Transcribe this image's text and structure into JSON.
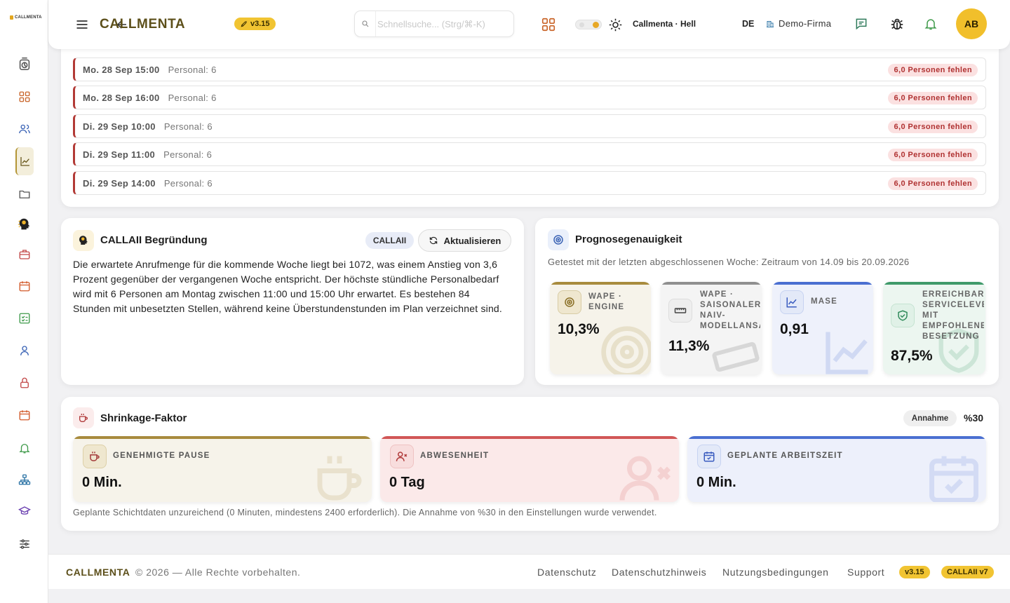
{
  "app": {
    "logo_text": "CALLMENTA",
    "brand": "CALLMENTA",
    "version": "v3.15"
  },
  "search": {
    "placeholder": "Schnellsuche... (Strg/⌘-K)",
    "value": ""
  },
  "header": {
    "theme_label": "Callmenta · Hell",
    "language": "DE",
    "company": "Demo-Firma",
    "avatar_initials": "AB"
  },
  "sidebar": {
    "items": [
      {
        "name": "sidebar-item-timer",
        "icon": "timer-icon"
      },
      {
        "name": "sidebar-item-dashboard",
        "icon": "grid-icon"
      },
      {
        "name": "sidebar-item-team",
        "icon": "users-icon"
      },
      {
        "name": "sidebar-item-forecast",
        "icon": "chart-line-icon",
        "active": true
      },
      {
        "name": "sidebar-item-files",
        "icon": "folder-icon"
      },
      {
        "name": "sidebar-item-ai",
        "icon": "ai-head-icon"
      },
      {
        "name": "sidebar-item-jobs",
        "icon": "briefcase-icon"
      },
      {
        "name": "sidebar-item-calendar",
        "icon": "calendar-icon"
      },
      {
        "name": "sidebar-item-tasks",
        "icon": "checklist-icon"
      },
      {
        "name": "sidebar-item-profile",
        "icon": "user-icon"
      },
      {
        "name": "sidebar-item-security",
        "icon": "lock-icon"
      },
      {
        "name": "sidebar-item-schedule",
        "icon": "calendar-alt-icon"
      },
      {
        "name": "sidebar-item-notifications",
        "icon": "bell-icon"
      },
      {
        "name": "sidebar-item-org",
        "icon": "org-chart-icon"
      },
      {
        "name": "sidebar-item-training",
        "icon": "graduation-cap-icon"
      },
      {
        "name": "sidebar-item-settings",
        "icon": "sliders-icon"
      }
    ]
  },
  "shortage": {
    "rows": [
      {
        "datetime": "Mo. 28 Sep 15:00",
        "personnel": "Personal: 6",
        "missing": "6,0 Personen fehlen"
      },
      {
        "datetime": "Mo. 28 Sep 16:00",
        "personnel": "Personal: 6",
        "missing": "6,0 Personen fehlen"
      },
      {
        "datetime": "Di. 29 Sep 10:00",
        "personnel": "Personal: 6",
        "missing": "6,0 Personen fehlen"
      },
      {
        "datetime": "Di. 29 Sep 11:00",
        "personnel": "Personal: 6",
        "missing": "6,0 Personen fehlen"
      },
      {
        "datetime": "Di. 29 Sep 14:00",
        "personnel": "Personal: 6",
        "missing": "6,0 Personen fehlen"
      }
    ]
  },
  "reasoning": {
    "title": "CALLAII Begründung",
    "badge": "CALLAII",
    "refresh_label": "Aktualisieren",
    "text": "Die erwartete Anrufmenge für die kommende Woche liegt bei 1072, was einem Anstieg von 3,6 Prozent gegenüber der vergangenen Woche entspricht. Der höchste stündliche Personalbedarf wird mit 6 Personen am Montag zwischen 11:00 und 15:00 Uhr erwartet. Es bestehen 84 Stunden mit unbesetzten Stellen, während keine Überstundenstunden im Plan verzeichnet sind."
  },
  "accuracy": {
    "title": "Prognosegenauigkeit",
    "subtitle": "Getestet mit der letzten abgeschlossenen Woche: Zeitraum von 14.09 bis 20.09.2026",
    "metrics": [
      {
        "label": "WAPE · ENGINE",
        "value": "10,3%",
        "icon": "target-icon",
        "color": "#a88b3d"
      },
      {
        "label": "WAPE · SAISONALER NAIV-MODELLANSATZ",
        "value": "11,3%",
        "icon": "ruler-icon",
        "color": "#8f8f8f"
      },
      {
        "label": "MASE",
        "value": "0,91",
        "icon": "chart-line-icon",
        "color": "#4a6fd1"
      },
      {
        "label": "ERREICHBARES SERVICELEVEL MIT EMPFOHLENER BESETZUNG",
        "value": "87,5%",
        "icon": "shield-check-icon",
        "color": "#3f9a6a"
      }
    ]
  },
  "shrinkage": {
    "title": "Shrinkage-Faktor",
    "assumption_label": "Annahme",
    "assumption_value": "%30",
    "items": [
      {
        "label": "GENEHMIGTE PAUSE",
        "value": "0 Min.",
        "icon": "coffee-icon",
        "color": "#a88b3d"
      },
      {
        "label": "ABWESENHEIT",
        "value": "0 Tag",
        "icon": "user-x-icon",
        "color": "#d15656"
      },
      {
        "label": "GEPLANTE ARBEITSZEIT",
        "value": "0 Min.",
        "icon": "calendar-check-icon",
        "color": "#4a6fd1"
      }
    ],
    "note": "Geplante Schichtdaten unzureichend (0 Minuten, mindestens 2400 erforderlich). Die Annahme von %30 in den Einstellungen wurde verwendet."
  },
  "footer": {
    "brand": "CALLMENTA",
    "copyright": "© 2026 — Alle Rechte vorbehalten.",
    "links": [
      "Datenschutz",
      "Datenschutzhinweis",
      "Nutzungsbedingungen",
      "Support"
    ],
    "version_badge": "v3.15",
    "ai_badge": "CALLAII v7"
  }
}
